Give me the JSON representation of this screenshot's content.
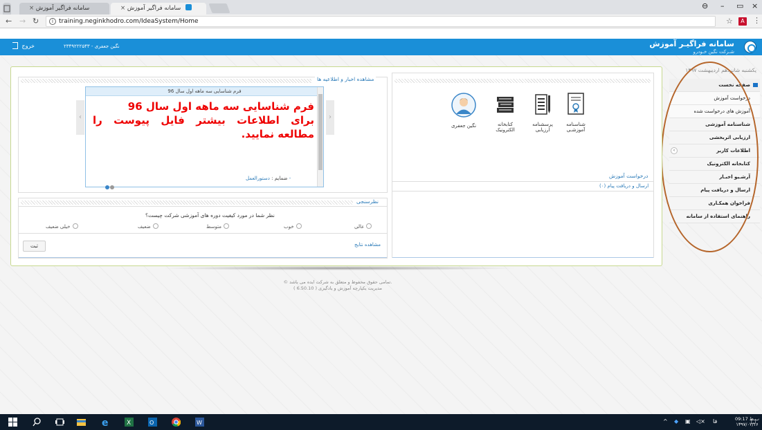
{
  "browser": {
    "tabs": [
      {
        "label": "سامانه فراگیر آموزش"
      },
      {
        "label": "سامانه فراگیر آموزش"
      }
    ],
    "url": "training.neginkhodro.com/IdeaSystem/Home"
  },
  "header": {
    "brand_title": "سامانه فراگیـر آموزش",
    "brand_subtitle": "شـرکت نگین خـودرو",
    "user": "نگین جعفری - ۲۳۴۹۲۲۲۵۴۳",
    "logout": "خروج"
  },
  "sidebar": {
    "date": "یکشنبه شانزدهم اردیبهشت ۱۳۹۷",
    "items": [
      {
        "label": "صفحه نخست"
      },
      {
        "label": "درخواست آموزش"
      },
      {
        "label": "آموزش های درخواست شده"
      },
      {
        "label": "شناسنامه آموزشی"
      },
      {
        "label": "ارزیابی اثربخشی"
      },
      {
        "label": "اطلاعات کاربر"
      },
      {
        "label": "کتابخانه الکترونیک"
      },
      {
        "label": "آرشـیو اخبـار"
      },
      {
        "label": "ارسال و دریافت پیام"
      },
      {
        "label": "فراخوان همکـاری"
      },
      {
        "label": "راهنمای استفاده از سامانه"
      }
    ]
  },
  "quick": {
    "icons": [
      {
        "label": "شناسنامه آموزشـی"
      },
      {
        "label": "پرسشنامه ارزیابی"
      },
      {
        "label": "کتابخانه الکترونیک"
      },
      {
        "label": "نگین جعفری"
      }
    ],
    "section_title": "درخواست آموزش",
    "link": "ارسال و دریافت پیام (۰)"
  },
  "news": {
    "title": "مشاهده اخبار و اطلاعیه ها",
    "slide_title": "فرم شناسایی سه ماهه اول سال 96",
    "slide_line1": "فرم شناسایی سه ماهه اول سال 96",
    "slide_line2": "برای اطلاعات بیشتر فایل پیوست را مطالعه نمایید.",
    "attachments_label": "ضمایم :",
    "attachment_link": "دستورالعمل -"
  },
  "poll": {
    "title": "نظرسنجی",
    "question": "نظر شما در مورد کیفیت دوره های آموزشی شرکت چیست؟",
    "options": [
      "عالی",
      "خوب",
      "متوسط",
      "ضعیف",
      "خیلی ضعیف"
    ],
    "results": "مشاهده نتایج",
    "submit": "ثبت"
  },
  "footer": {
    "line1": "© تمامی حقوق محفوظ و متعلق به شرکت ایده می باشد.",
    "line2": "مدیریت یکپارچه آموزش و یادگیری ( 6.50.10 )"
  },
  "taskbar": {
    "time": "09:17 ب.ظ",
    "date": "۱۳۹۷/۰۲/۱۶"
  }
}
